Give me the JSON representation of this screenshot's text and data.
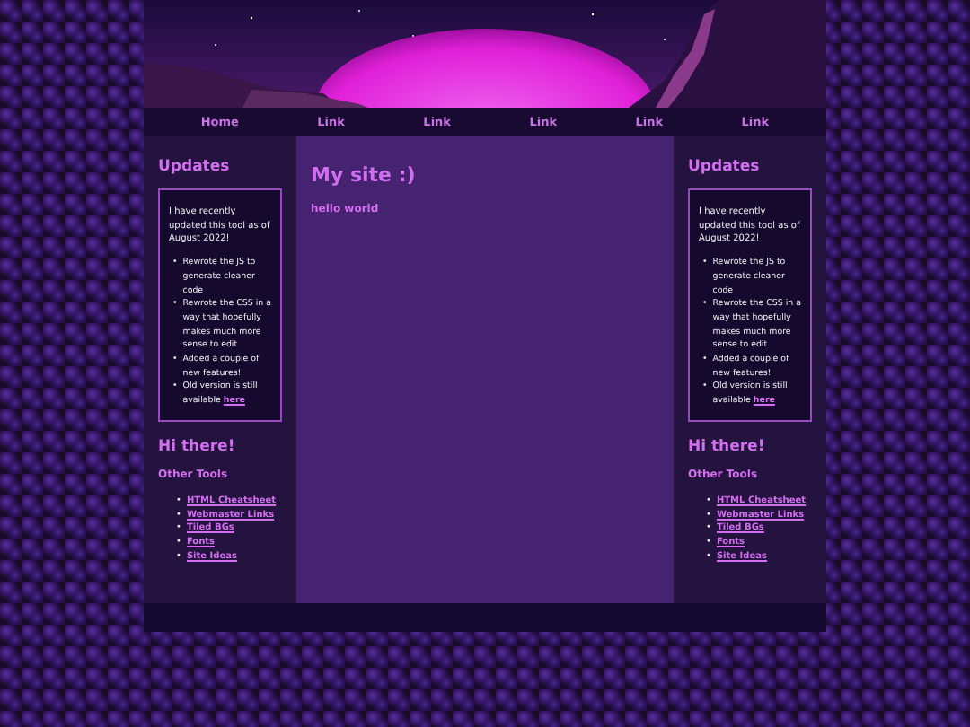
{
  "nav": [
    {
      "label": "Home"
    },
    {
      "label": "Link"
    },
    {
      "label": "Link"
    },
    {
      "label": "Link"
    },
    {
      "label": "Link"
    },
    {
      "label": "Link"
    }
  ],
  "sidebars": [
    {
      "title": "Updates",
      "intro": "I have recently updated this tool as of August 2022!",
      "items": [
        {
          "bullet": "•",
          "text": "Rewrote the JS to generate cleaner code"
        },
        {
          "bullet": "•",
          "text": "Rewrote the CSS in a way that hopefully makes much more sense to edit"
        },
        {
          "bullet": "•",
          "text": "Added a couple of new features!"
        },
        {
          "bullet": "•",
          "text": "Old version is still available",
          "link": "here"
        }
      ],
      "greeting": "Hi there!",
      "tools_title": "Other Tools",
      "tools": [
        {
          "bullet": "•",
          "label": "HTML Cheatsheet"
        },
        {
          "bullet": "•",
          "label": "Webmaster Links"
        },
        {
          "bullet": "•",
          "label": "Tiled BGs"
        },
        {
          "bullet": "•",
          "label": "Fonts"
        },
        {
          "bullet": "•",
          "label": "Site Ideas"
        }
      ]
    },
    {
      "title": "Updates",
      "intro": "I have recently updated this tool as of August 2022!",
      "items": [
        {
          "bullet": "•",
          "text": "Rewrote the JS to generate cleaner code"
        },
        {
          "bullet": "•",
          "text": "Rewrote the CSS in a way that hopefully makes much more sense to edit"
        },
        {
          "bullet": "•",
          "text": "Added a couple of new features!"
        },
        {
          "bullet": "•",
          "text": "Old version is still available",
          "link": "here"
        }
      ],
      "greeting": "Hi there!",
      "tools_title": "Other Tools",
      "tools": [
        {
          "bullet": "•",
          "label": "HTML Cheatsheet"
        },
        {
          "bullet": "•",
          "label": "Webmaster Links"
        },
        {
          "bullet": "•",
          "label": "Tiled BGs"
        },
        {
          "bullet": "•",
          "label": "Fonts"
        },
        {
          "bullet": "•",
          "label": "Site Ideas"
        }
      ]
    }
  ],
  "main": {
    "title": "My site :)",
    "text": "hello world"
  }
}
